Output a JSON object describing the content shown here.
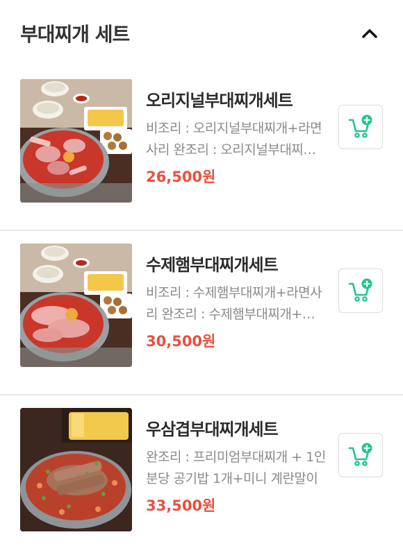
{
  "section": {
    "title": "부대찌개 세트"
  },
  "items": [
    {
      "name": "오리지널부대찌개세트",
      "description": "비조리 : 오리지널부대찌개+라면사리 완조리 : 오리지널부대찌개+라면사리",
      "price": "26,500원"
    },
    {
      "name": "수제햄부대찌개세트",
      "description": "비조리 : 수제햄부대찌개+라면사리 완조리 : 수제햄부대찌개+라면사리",
      "price": "30,500원"
    },
    {
      "name": "우삼겹부대찌개세트",
      "description": "완조리 : 프리미엄부대찌개 + 1인분당 공기밥 1개+미니 계란말이",
      "price": "33,500원"
    }
  ],
  "colors": {
    "price": "#e9503f",
    "cart_accent": "#1dc593"
  },
  "icons": {
    "collapse": "chevron-up-icon",
    "cart": "cart-add-icon"
  }
}
